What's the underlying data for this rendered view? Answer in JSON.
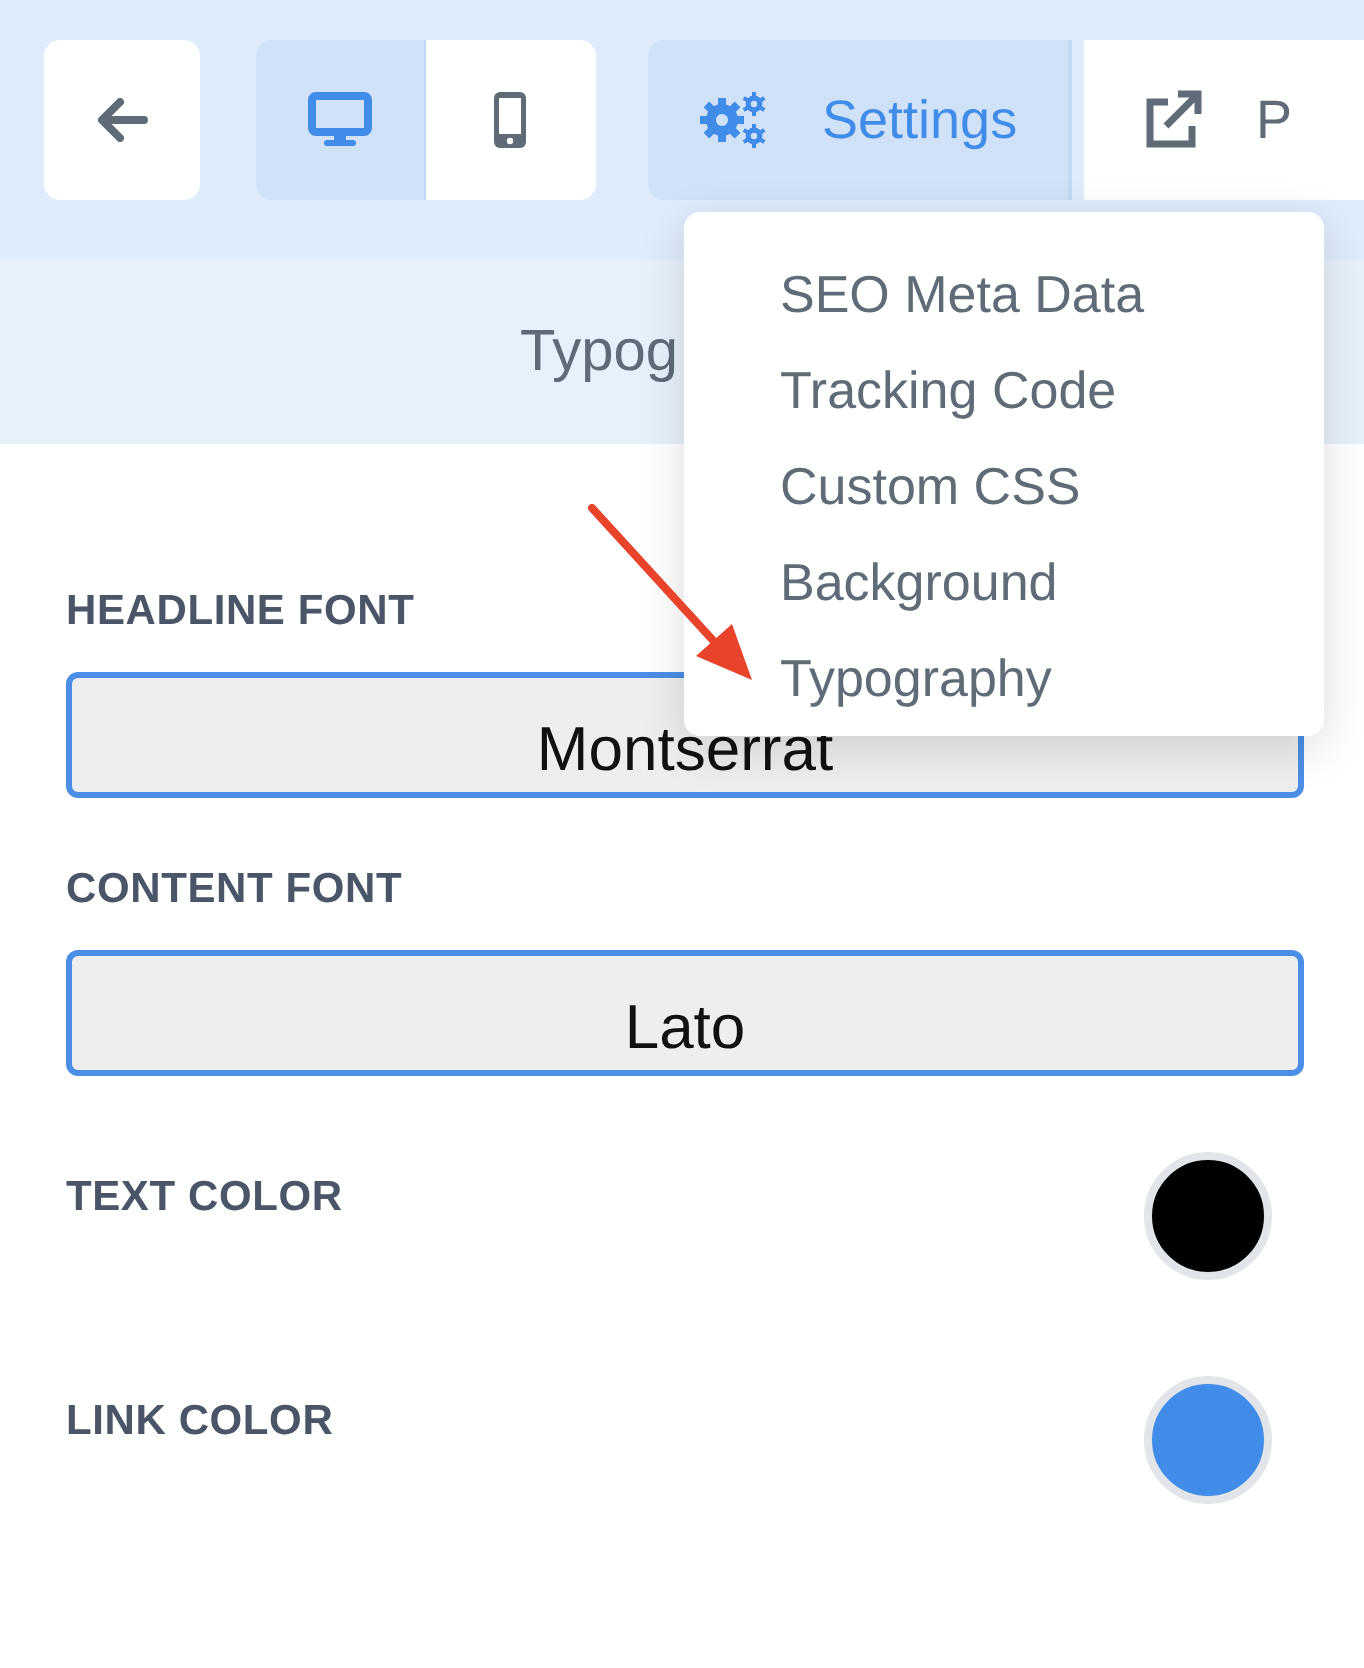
{
  "toolbar": {
    "views": [
      {
        "kind": "desktop",
        "selected": true
      },
      {
        "kind": "mobile",
        "selected": false
      }
    ],
    "settings": {
      "label": "Settings",
      "selected": true
    },
    "preview": {
      "label": "P"
    }
  },
  "section_title": "Typog",
  "menu": [
    {
      "label": "SEO Meta Data"
    },
    {
      "label": "Tracking Code"
    },
    {
      "label": "Custom CSS"
    },
    {
      "label": "Background"
    },
    {
      "label": "Typography"
    }
  ],
  "fonts": [
    {
      "label": "HEADLINE FONT",
      "value": "Montserrat"
    },
    {
      "label": "CONTENT FONT",
      "value": "Lato"
    }
  ],
  "colors": [
    {
      "label": "TEXT COLOR",
      "color": "#000000"
    },
    {
      "label": "LINK COLOR",
      "color": "#418ce9"
    }
  ]
}
